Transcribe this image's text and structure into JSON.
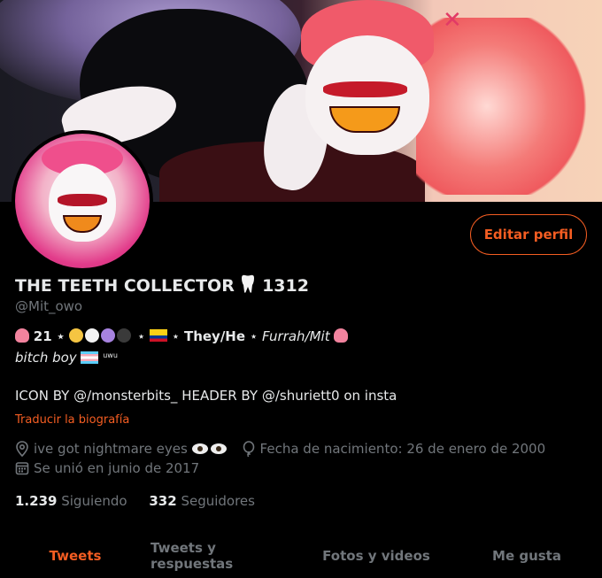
{
  "profile": {
    "display_name": "THE TEETH COLLECTOR",
    "name_suffix": "1312",
    "handle": "@Mit_owo",
    "edit_button": "Editar perfil",
    "bio_line1_a": "21 ⋆",
    "bio_line1_b": "⋆",
    "bio_line1_c": "⋆",
    "bio_pronouns": "They/He",
    "bio_line1_d": "⋆",
    "bio_names": "Furrah/Mit",
    "bio_line2": "bitch boy",
    "bio_uwu": "uwu",
    "bio_line3": "ICON BY @/monsterbits_ HEADER BY @/shuriett0 on insta",
    "translate_link": "Traducir la biografía",
    "location": "ive got nightmare eyes",
    "birthday": "Fecha de nacimiento: 26 de enero de 2000",
    "joined": "Se unió en junio de 2017",
    "following_count": "1.239",
    "following_label": "Siguiendo",
    "followers_count": "332",
    "followers_label": "Seguidores"
  },
  "tabs": [
    {
      "label": "Tweets",
      "active": true
    },
    {
      "label": "Tweets y respuestas",
      "active": false
    },
    {
      "label": "Fotos y videos",
      "active": false
    },
    {
      "label": "Me gusta",
      "active": false
    }
  ],
  "colors": {
    "accent": "#f45d22",
    "background": "#000000",
    "text_primary": "#e7e9ea",
    "text_secondary": "#71767b"
  },
  "icons": {
    "location": "location-pin-icon",
    "birthday": "balloon-icon",
    "joined": "calendar-icon"
  }
}
